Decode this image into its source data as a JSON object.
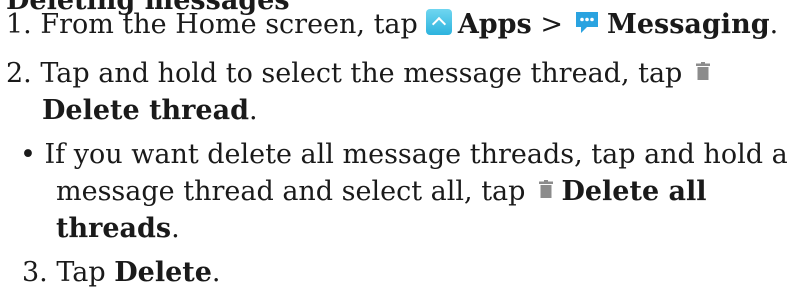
{
  "heading_partial": "Deleting messages",
  "steps": {
    "step1": {
      "prefix": "1. From the Home screen, tap",
      "apps": "Apps",
      "separator": " >",
      "messaging": "Messaging",
      "end": "."
    },
    "step2": {
      "prefix": "2. Tap and hold to select the message thread, tap",
      "delete_thread": "Delete thread",
      "end": "."
    },
    "bullet": {
      "line1": "• If you want delete all message threads, tap and hold a",
      "line2_prefix": "message thread and select all, tap",
      "delete_all": "Delete all",
      "line3_bold": "threads",
      "end": "."
    },
    "step3": {
      "prefix": "3. Tap ",
      "delete": "Delete",
      "end": "."
    }
  },
  "icons": {
    "apps": "apps-chevron-icon",
    "messaging": "messaging-icon",
    "trash": "trash-icon"
  },
  "colors": {
    "text": "#1a1a1a",
    "apps_icon": "#2db3de",
    "messaging_icon": "#2aa3e0",
    "trash_icon": "#8c8c8c"
  }
}
